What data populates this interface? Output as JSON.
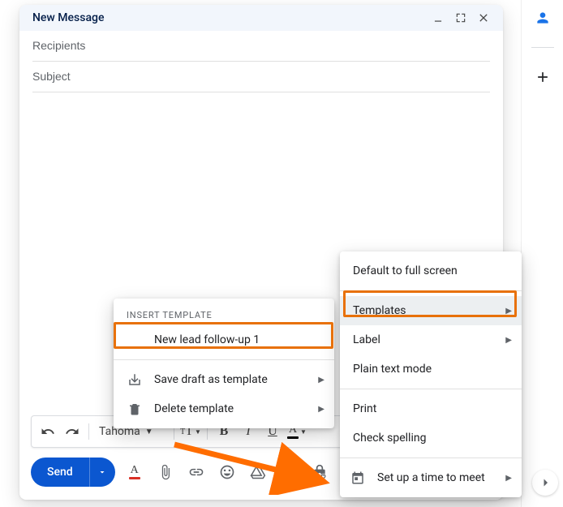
{
  "compose": {
    "title": "New Message",
    "recipients_placeholder": "Recipients",
    "subject_placeholder": "Subject"
  },
  "format": {
    "font": "Tahoma"
  },
  "send": {
    "label": "Send"
  },
  "template_menu": {
    "heading": "Insert template",
    "item_new_lead": "New lead follow-up 1",
    "item_save": "Save draft as template",
    "item_delete": "Delete template"
  },
  "more_menu": {
    "fullscreen": "Default to full screen",
    "templates": "Templates",
    "label": "Label",
    "plaintext": "Plain text mode",
    "print": "Print",
    "spelling": "Check spelling",
    "schedule": "Set up a time to meet"
  },
  "colors": {
    "highlight": "#e8710a",
    "primary": "#0b57d0"
  }
}
